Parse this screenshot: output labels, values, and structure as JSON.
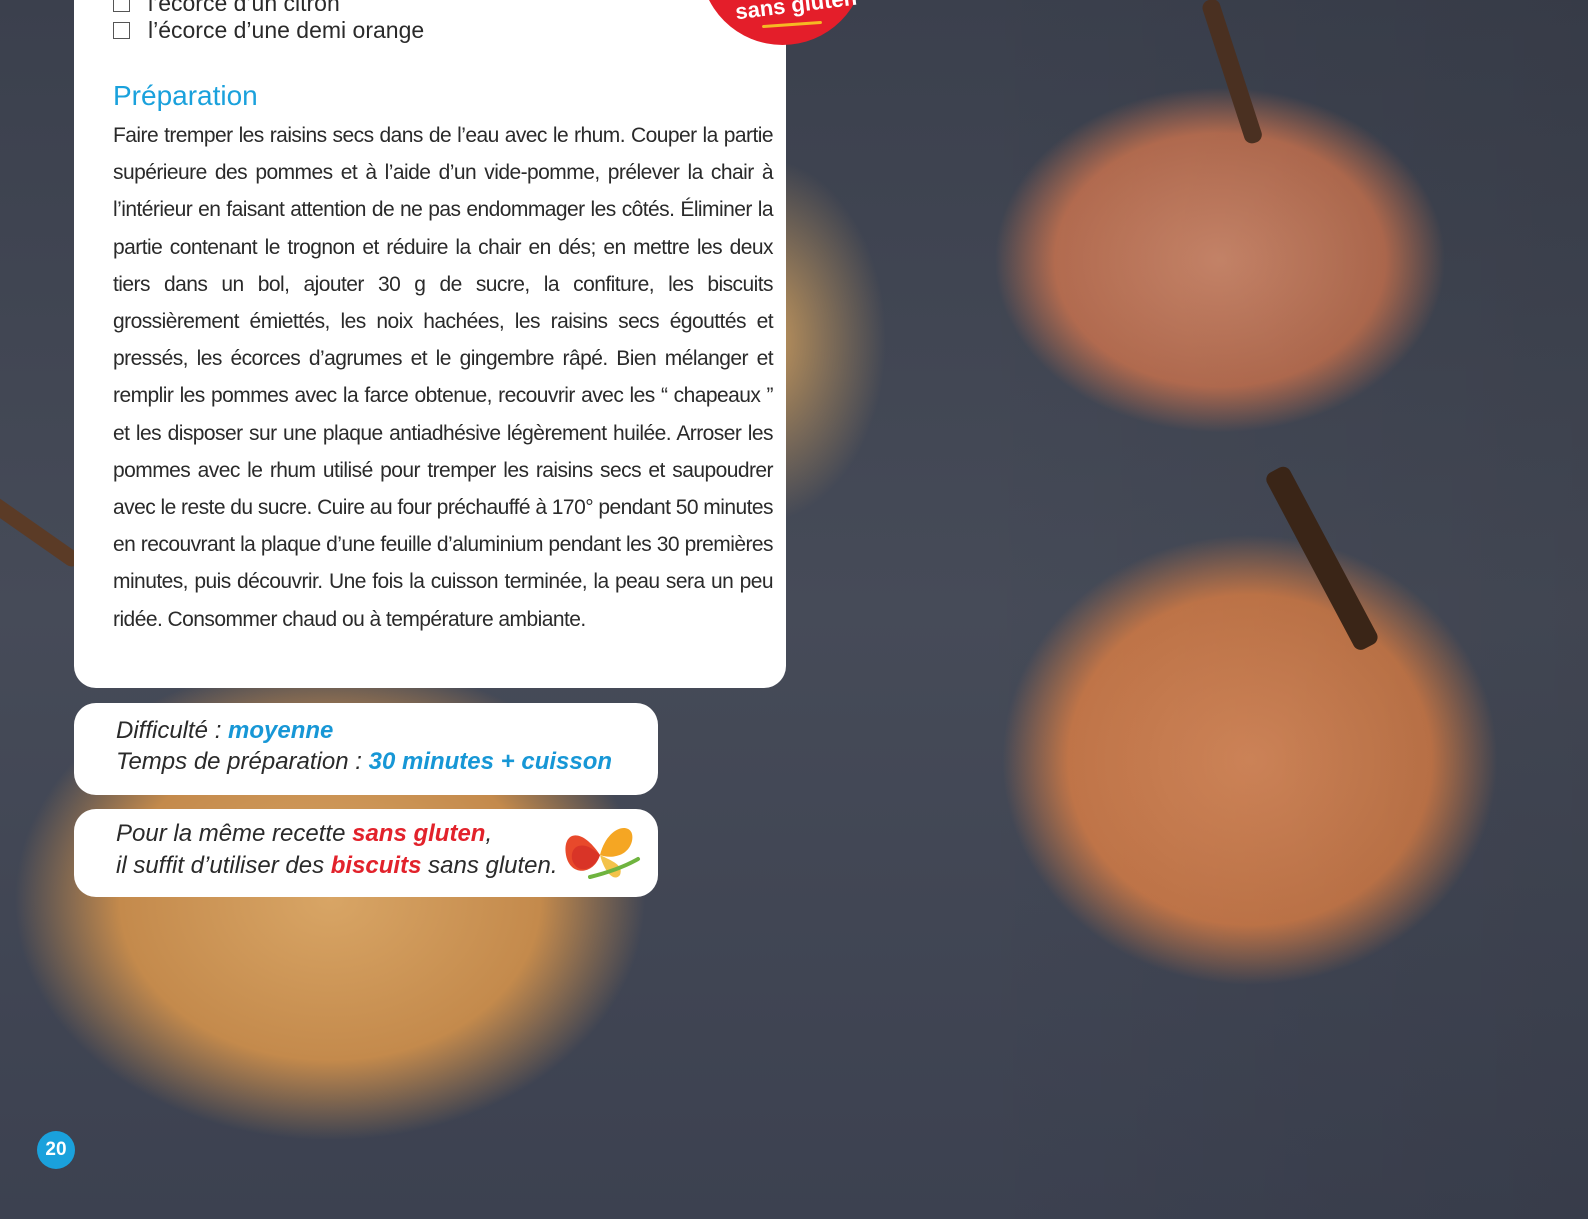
{
  "badge": {
    "text": "sans gluten"
  },
  "ingredients": [
    {
      "text": "l’écorce d’un citron"
    },
    {
      "text": "l’écorce d’une demi orange"
    }
  ],
  "preparation": {
    "title": "Préparation",
    "text": "Faire tremper les raisins secs dans de l’eau avec le rhum. Couper la partie supérieure des pommes et à l’aide d’un vide-pomme, prélever la chair à l’intérieur en faisant attention de ne pas endommager les côtés. Éliminer la partie contenant le trognon et réduire la chair en dés; en mettre les deux tiers dans un bol, ajouter 30 g de sucre, la confiture, les biscuits grossièrement émiettés, les noix hachées, les raisins secs égouttés et pressés, les écorces d’agrumes et le gingembre râpé. Bien mélanger et remplir les pommes avec la farce obtenue, recouvrir avec les “ chapeaux ” et les disposer sur une plaque antiadhésive légèrement huilée. Arroser les pommes avec le rhum utilisé pour tremper les raisins secs et saupoudrer avec le reste du sucre. Cuire au four préchauffé à 170° pendant 50 minutes en recouvrant la plaque d’une feuille d’aluminium pendant les 30 premières minutes, puis découvrir. Une fois la cuisson terminée, la peau sera un peu ridée. Consommer chaud ou à température ambiante."
  },
  "info": {
    "difficulty_label": "Difficulté : ",
    "difficulty_value": "moyenne",
    "time_label": "Temps de préparation : ",
    "time_value": "30 minutes + cuisson"
  },
  "gluten_note": {
    "line1_prefix": "Pour la même recette ",
    "line1_highlight": "sans gluten",
    "line1_suffix": ",",
    "line2_prefix": "il suffit d’utiliser des ",
    "line2_highlight": "biscuits",
    "line2_suffix": " sans gluten."
  },
  "page_number": "20",
  "colors": {
    "accent_blue": "#1aa1dc",
    "accent_red": "#e2222b",
    "badge_red": "#e41e2a"
  },
  "icons": {
    "logo": "butterfly-logo-icon",
    "checkbox": "checkbox-icon"
  }
}
